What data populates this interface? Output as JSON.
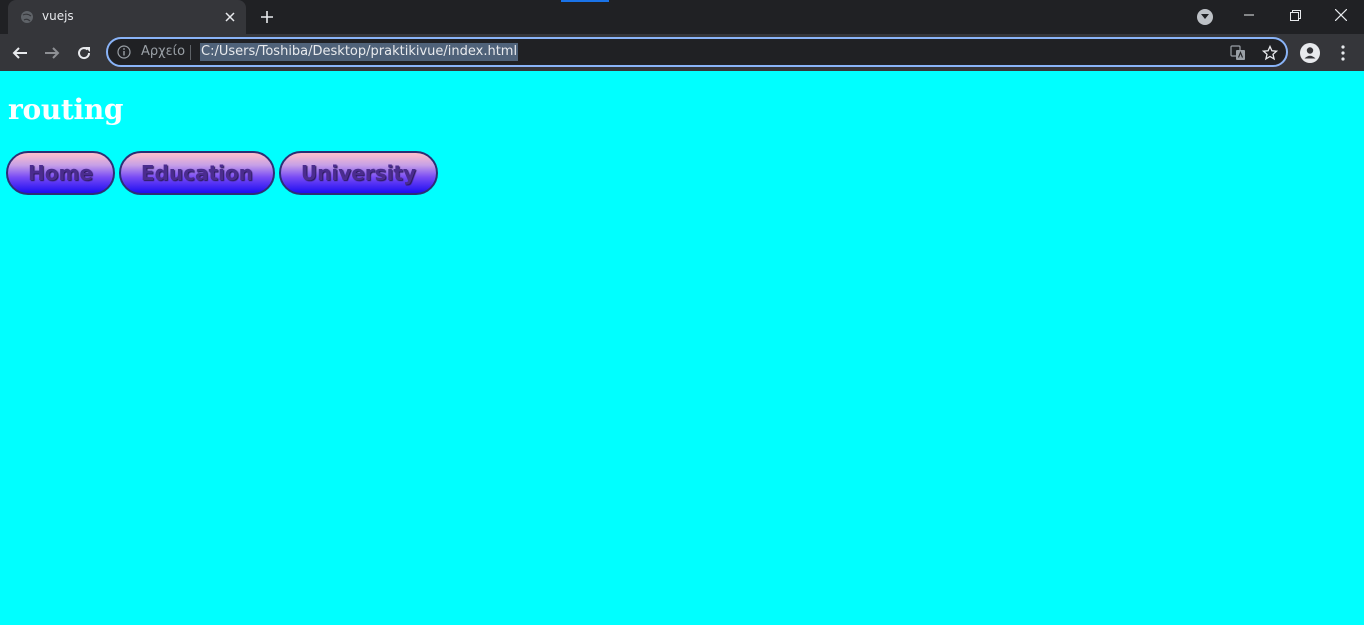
{
  "browser": {
    "tab": {
      "title": "vuejs"
    },
    "omnibox": {
      "scheme_label": "Αρχείο",
      "url": "C:/Users/Toshiba/Desktop/praktikivue/index.html"
    }
  },
  "page": {
    "title": "routing",
    "nav": [
      {
        "label": "Home"
      },
      {
        "label": "Education"
      },
      {
        "label": "University"
      }
    ]
  },
  "colors": {
    "page_background": "#00ffff",
    "title_color": "#ffffff",
    "button_gradient_top": "#ffc0cb",
    "button_gradient_bottom": "#1e0df2",
    "button_text": "#4b2c8f"
  }
}
